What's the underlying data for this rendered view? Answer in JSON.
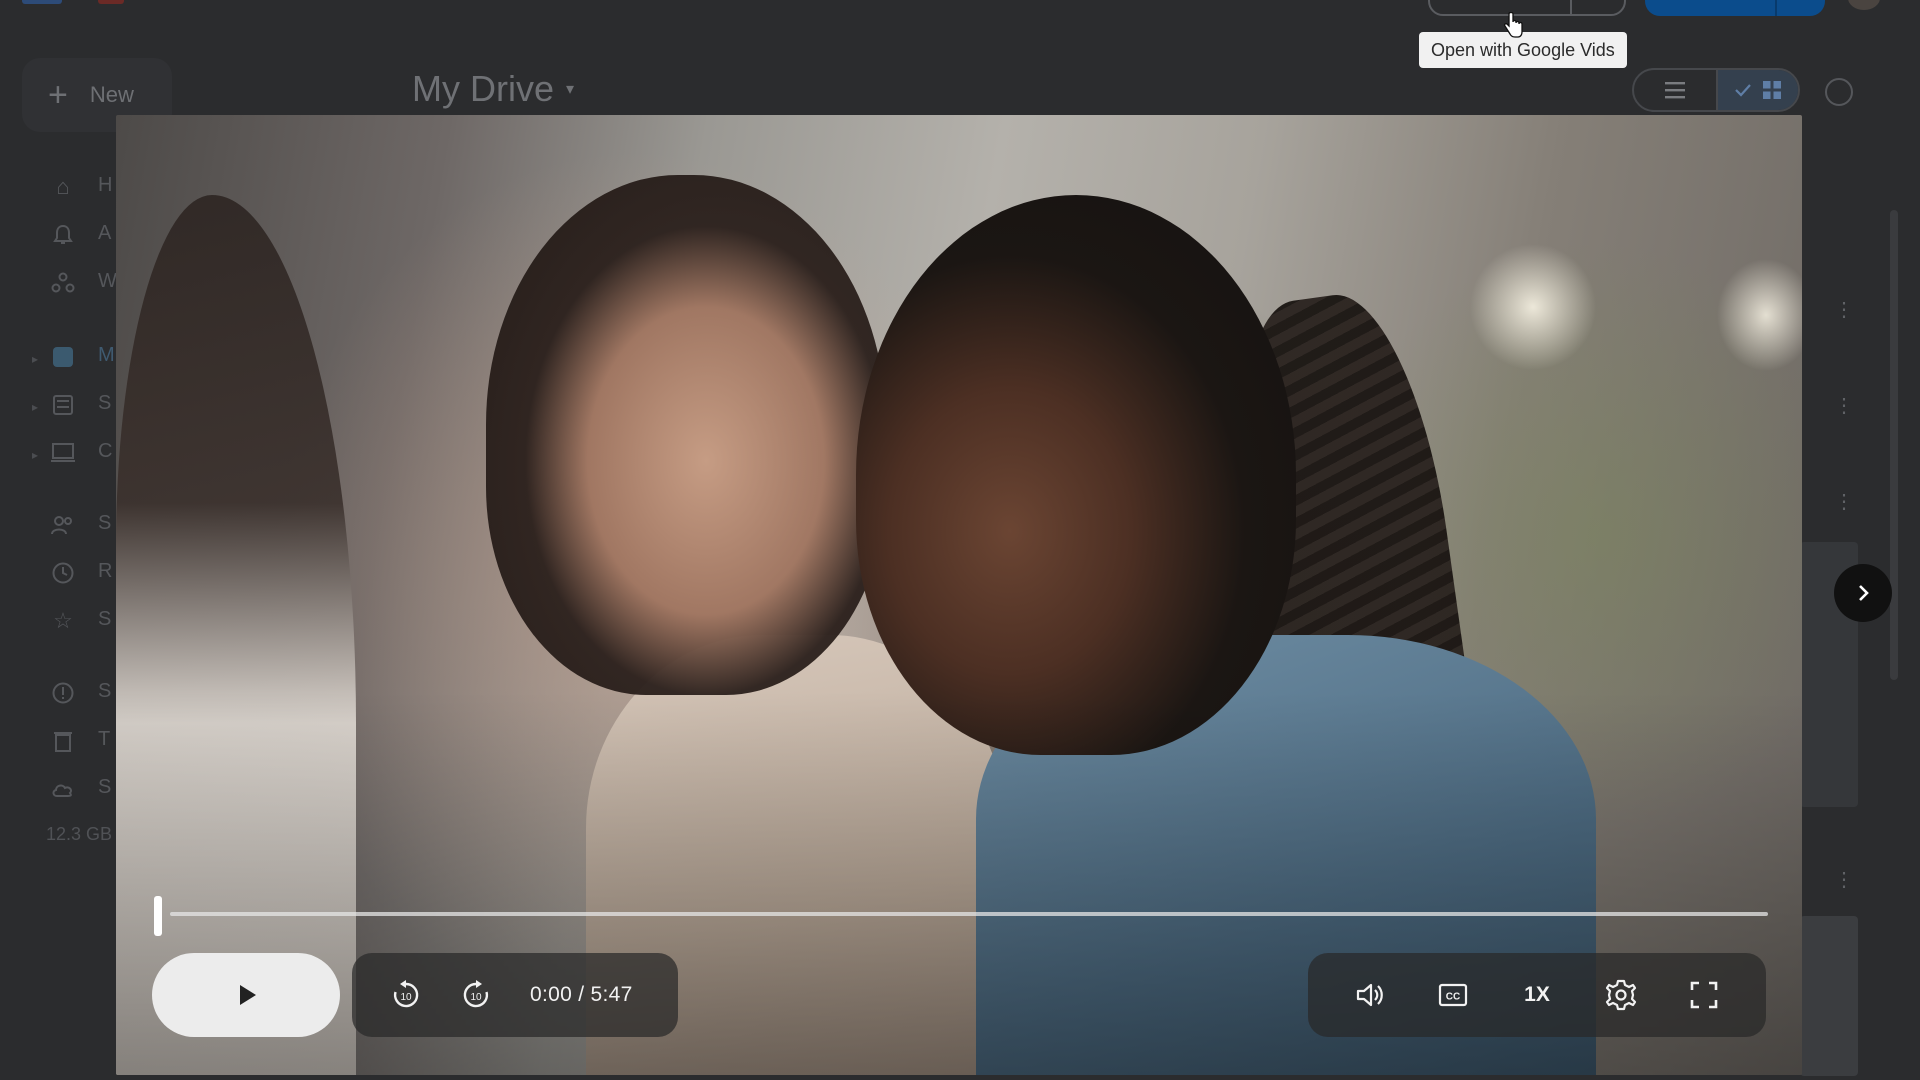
{
  "topbar": {
    "tooltip": "Open with Google Vids"
  },
  "drive": {
    "new_label": "New",
    "plus_glyph": "+",
    "title": "My Drive",
    "title_caret": "▾",
    "storage": "12.3 GB",
    "sidebar_letters": [
      "H",
      "A",
      "W",
      "M",
      "S",
      "C",
      "S",
      "R",
      "S",
      "S",
      "T",
      "S"
    ]
  },
  "player": {
    "time_display": "0:00 / 5:47",
    "speed_label": "1X",
    "progress_fraction": 0.0
  },
  "icons": {
    "play": "play-icon",
    "rewind10": "replay-10-icon",
    "forward10": "forward-10-icon",
    "volume": "volume-icon",
    "captions": "closed-captions-icon",
    "settings": "gear-icon",
    "fullscreen": "fullscreen-icon",
    "next": "chevron-right-icon"
  },
  "colors": {
    "accent_blue": "#0b4c8c",
    "player_pill": "#282828",
    "play_button": "#ececec"
  }
}
